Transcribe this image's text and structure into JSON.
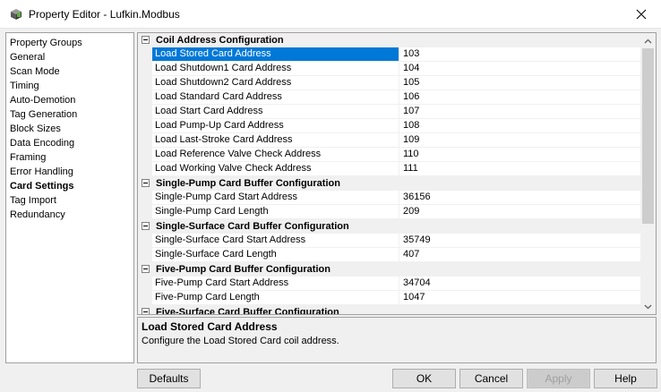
{
  "window": {
    "title": "Property Editor - Lufkin.Modbus"
  },
  "nav": {
    "items": [
      {
        "label": "Property Groups",
        "active": false
      },
      {
        "label": "General",
        "active": false
      },
      {
        "label": "Scan Mode",
        "active": false
      },
      {
        "label": "Timing",
        "active": false
      },
      {
        "label": "Auto-Demotion",
        "active": false
      },
      {
        "label": "Tag Generation",
        "active": false
      },
      {
        "label": "Block Sizes",
        "active": false
      },
      {
        "label": "Data Encoding",
        "active": false
      },
      {
        "label": "Framing",
        "active": false
      },
      {
        "label": "Error Handling",
        "active": false
      },
      {
        "label": "Card Settings",
        "active": true
      },
      {
        "label": "Tag Import",
        "active": false
      },
      {
        "label": "Redundancy",
        "active": false
      }
    ]
  },
  "grid": {
    "categories": [
      {
        "name": "Coil Address Configuration",
        "properties": [
          {
            "name": "Load Stored Card Address",
            "value": "103",
            "selected": true
          },
          {
            "name": "Load Shutdown1 Card Address",
            "value": "104"
          },
          {
            "name": "Load Shutdown2 Card Address",
            "value": "105"
          },
          {
            "name": "Load Standard Card Address",
            "value": "106"
          },
          {
            "name": "Load Start Card Address",
            "value": "107"
          },
          {
            "name": "Load Pump-Up Card Address",
            "value": "108"
          },
          {
            "name": "Load Last-Stroke Card Address",
            "value": "109"
          },
          {
            "name": "Load Reference Valve Check Address",
            "value": "110"
          },
          {
            "name": "Load Working Valve Check Address",
            "value": "111"
          }
        ]
      },
      {
        "name": "Single-Pump Card Buffer Configuration",
        "properties": [
          {
            "name": "Single-Pump Card Start Address",
            "value": "36156"
          },
          {
            "name": "Single-Pump Card Length",
            "value": "209"
          }
        ]
      },
      {
        "name": "Single-Surface Card Buffer Configuration",
        "properties": [
          {
            "name": "Single-Surface Card Start Address",
            "value": "35749"
          },
          {
            "name": "Single-Surface Card Length",
            "value": "407"
          }
        ]
      },
      {
        "name": "Five-Pump Card Buffer Configuration",
        "properties": [
          {
            "name": "Five-Pump Card Start Address",
            "value": "34704"
          },
          {
            "name": "Five-Pump Card Length",
            "value": "1047"
          }
        ]
      },
      {
        "name": "Five-Surface Card Buffer Configuration",
        "properties": []
      }
    ]
  },
  "description": {
    "title": "Load Stored Card Address",
    "text": "Configure the Load Stored Card coil address."
  },
  "buttons": {
    "defaults": "Defaults",
    "ok": "OK",
    "cancel": "Cancel",
    "apply": "Apply",
    "help": "Help"
  },
  "colors": {
    "selection": "#0078d7",
    "category_bg": "#f0f0f0"
  }
}
